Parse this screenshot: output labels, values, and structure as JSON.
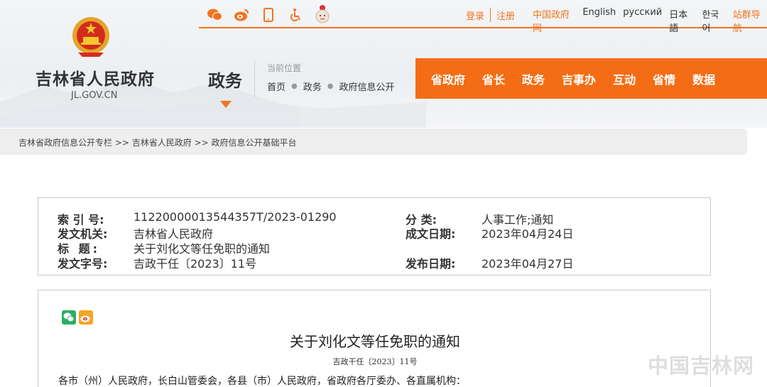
{
  "header": {
    "site_title": "吉林省人民政府",
    "site_domain": "JL.GOV.CN",
    "section_title": "政务",
    "location_label": "当前位置",
    "location_crumbs": [
      "首页",
      "政务",
      "政府信息公开"
    ]
  },
  "topbar": {
    "icons": [
      "weibo-round-icon",
      "weibo-icon",
      "mobile-icon",
      "accessibility-icon",
      "mascot-icon"
    ],
    "login": "登录",
    "register": "注册",
    "links": [
      "中国政府网",
      "English",
      "русский",
      "日本語",
      "한국어",
      "站群导航"
    ]
  },
  "mainnav": [
    "省政府",
    "省长",
    "政务",
    "吉事办",
    "互动",
    "省情",
    "数据"
  ],
  "breadcrumb": "吉林省政府信息公开专栏 >> 吉林省人民政府 >> 政府信息公开基础平台",
  "info": {
    "index_label": "索 引 号:",
    "index_value": "11220000013544357T/2023-01290",
    "category_label": "分 类:",
    "category_value": "人事工作;通知",
    "issuer_label": "发文机关:",
    "issuer_value": "吉林省人民政府",
    "created_label": "成文日期:",
    "created_value": "2023年04月24日",
    "title_label": "标 题:",
    "title_value": "关于刘化文等任免职的通知",
    "docno_label": "发文字号:",
    "docno_value": "吉政干任〔2023〕11号",
    "published_label": "发布日期:",
    "published_value": "2023年04月27日"
  },
  "article": {
    "title": "关于刘化文等任免职的通知",
    "doc_number": "吉政干任〔2023〕11号",
    "salutation": "各市（州）人民政府，长白山管委会，各县（市）人民政府，省政府各厅委办、各直属机构："
  },
  "watermark": "中国吉林网",
  "colors": {
    "accent": "#f46d15",
    "text": "#333333"
  }
}
